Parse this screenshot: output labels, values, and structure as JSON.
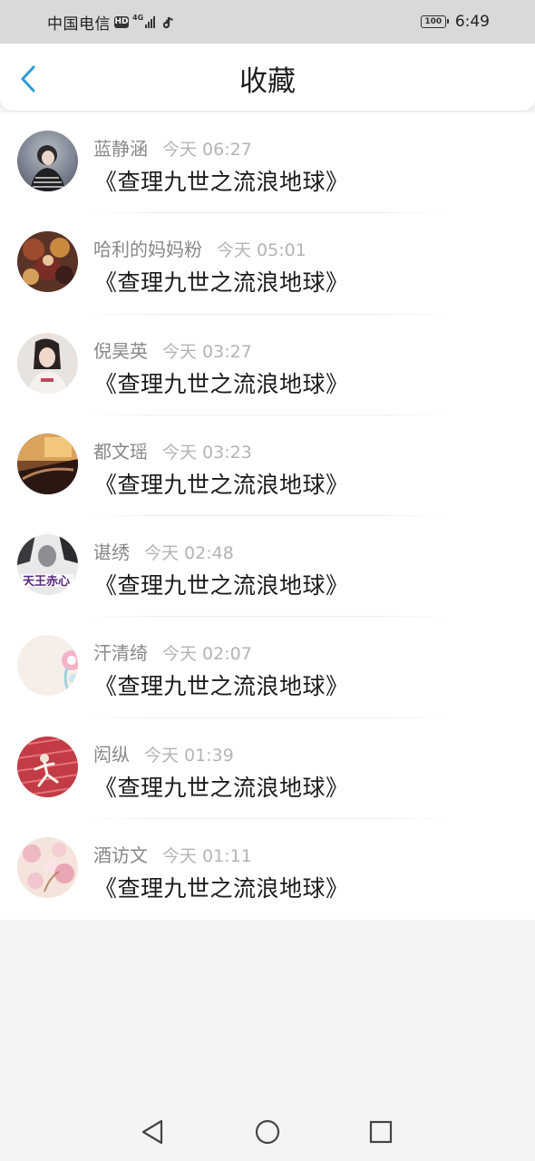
{
  "status_bar": {
    "carrier": "中国电信",
    "hd_badge": "HD",
    "network_type": "4G",
    "battery": "100",
    "time": "6:49"
  },
  "header": {
    "title": "收藏",
    "back_icon": "chevron-left-icon",
    "accent_color": "#2f9bd8"
  },
  "favorites": [
    {
      "user": "蓝静涵",
      "time": "今天 06:27",
      "title": "《查理九世之流浪地球》"
    },
    {
      "user": "哈利的妈妈粉",
      "time": "今天 05:01",
      "title": "《查理九世之流浪地球》"
    },
    {
      "user": "倪昊英",
      "time": "今天 03:27",
      "title": "《查理九世之流浪地球》"
    },
    {
      "user": "都文瑶",
      "time": "今天 03:23",
      "title": "《查理九世之流浪地球》"
    },
    {
      "user": "谌绣",
      "time": "今天 02:48",
      "title": "《查理九世之流浪地球》"
    },
    {
      "user": "汗清绮",
      "time": "今天 02:07",
      "title": "《查理九世之流浪地球》"
    },
    {
      "user": "闳纵",
      "time": "今天 01:39",
      "title": "《查理九世之流浪地球》"
    },
    {
      "user": "酒访文",
      "time": "今天 01:11",
      "title": "《查理九世之流浪地球》"
    }
  ],
  "nav": {
    "back_icon": "triangle-back-icon",
    "home_icon": "circle-home-icon",
    "recents_icon": "square-recents-icon"
  }
}
